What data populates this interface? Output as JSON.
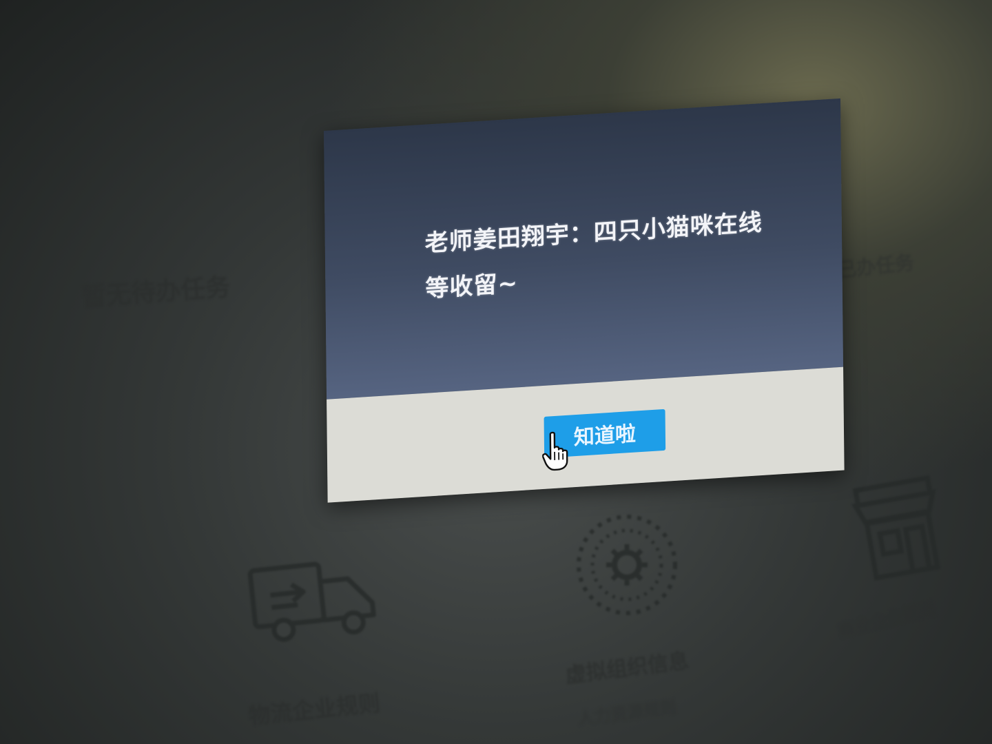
{
  "background": {
    "empty_tasks_text": "暂无待办任务",
    "done_tasks_text": "已办任务",
    "tiles": [
      {
        "label": "物流企业规则",
        "icon": "truck-icon"
      },
      {
        "label": "虚拟组织信息",
        "sublabel": "人力资源规则",
        "icon": "gear-circle-icon"
      },
      {
        "label": "商业企业规则",
        "icon": "storefront-icon"
      }
    ]
  },
  "dialog": {
    "message_line1": "老师姜田翔宇：四只小猫咪在线",
    "message_line2": "等收留~",
    "confirm_label": "知道啦"
  },
  "colors": {
    "dialog_body": "#3f4b62",
    "dialog_footer": "#dcdcd6",
    "button": "#1e9ee8"
  }
}
